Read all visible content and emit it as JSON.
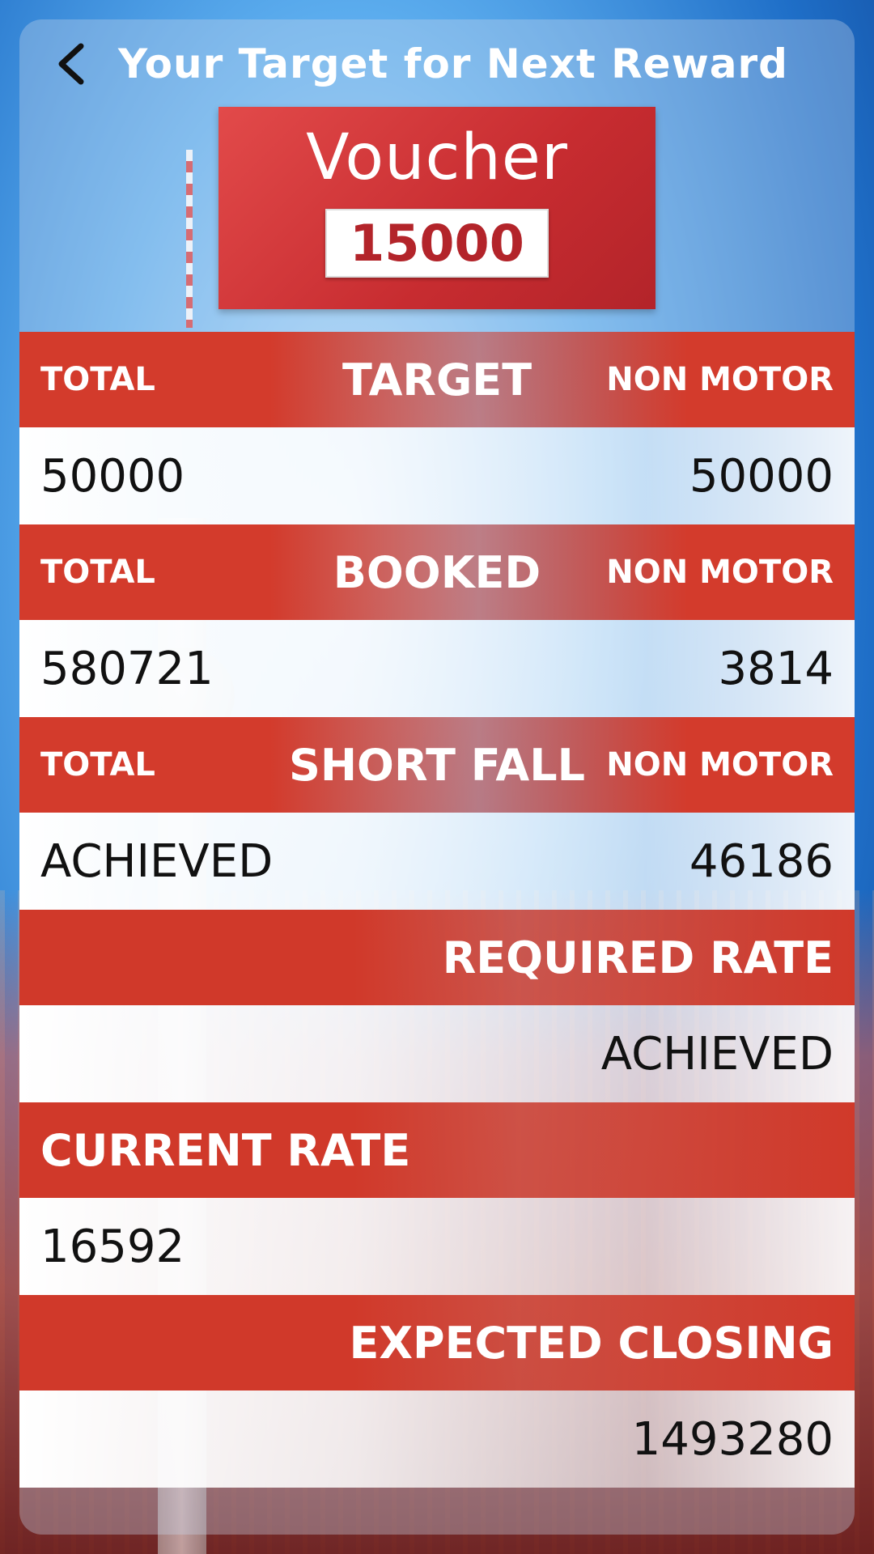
{
  "header": {
    "title": "Your Target for Next Reward"
  },
  "voucher": {
    "label": "Voucher",
    "amount": "15000"
  },
  "sections": {
    "target": {
      "left_label": "TOTAL",
      "title": "TARGET",
      "right_label": "NON MOTOR",
      "total_value": "50000",
      "non_motor_value": "50000"
    },
    "booked": {
      "left_label": "TOTAL",
      "title": "BOOKED",
      "right_label": "NON MOTOR",
      "total_value": "580721",
      "non_motor_value": "3814"
    },
    "short_fall": {
      "left_label": "TOTAL",
      "title": "SHORT FALL",
      "right_label": "NON MOTOR",
      "total_value": "ACHIEVED",
      "non_motor_value": "46186"
    },
    "required_rate": {
      "title": "REQUIRED RATE",
      "value": "ACHIEVED"
    },
    "current_rate": {
      "title": "CURRENT RATE",
      "value": "16592"
    },
    "expected_closing": {
      "title": "EXPECTED CLOSING",
      "value": "1493280"
    }
  },
  "colors": {
    "accent_red": "#d33b2c",
    "voucher_red": "#c72c30",
    "sky_blue": "#5fb0f0"
  }
}
